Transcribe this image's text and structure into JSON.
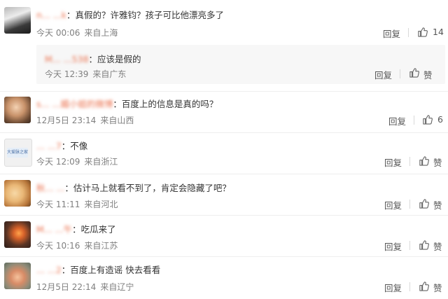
{
  "comments": [
    {
      "username": "n... ...k",
      "text": "：真假的？许雅钧？孩子可比他漂亮多了",
      "time": "今天 00:06",
      "source": "来自上海",
      "reply_label": "回复",
      "like_count": "14",
      "sub_reply": {
        "username": "M... ...538",
        "text": "：应该是假的",
        "time": "今天 12:39",
        "source": "来自广东",
        "reply_label": "回复",
        "like_label": "赞"
      }
    },
    {
      "username": "s... ...媚小姐的微博",
      "text": "：百度上的信息是真的吗？",
      "time": "12月5日 23:14",
      "source": "来自山西",
      "reply_label": "回复",
      "like_count": "6"
    },
    {
      "username": "... ...7",
      "avatar_text": "大爱脉之家",
      "text": "：不像",
      "time": "今天 12:09",
      "source": "来自浙江",
      "reply_label": "回复",
      "like_label": "赞"
    },
    {
      "username": "秋... ...",
      "text": "：估计马上就看不到了，肯定会隐藏了吧？",
      "time": "今天 11:11",
      "source": "来自河北",
      "reply_label": "回复",
      "like_label": "赞"
    },
    {
      "username": "M... ...午",
      "text": "：吃瓜来了",
      "time": "今天 10:16",
      "source": "来自江苏",
      "reply_label": "回复",
      "like_label": "赞"
    },
    {
      "username": "... ...2",
      "text": "：百度上有造谣 快去看看",
      "time": "12月5日 22:14",
      "source": "来自辽宁",
      "reply_label": "回复",
      "like_label": "赞"
    }
  ],
  "colors": {
    "username": "#eb7350",
    "meta": "#808080",
    "text": "#333333"
  },
  "icons": {
    "like": "thumbs-up-icon"
  }
}
